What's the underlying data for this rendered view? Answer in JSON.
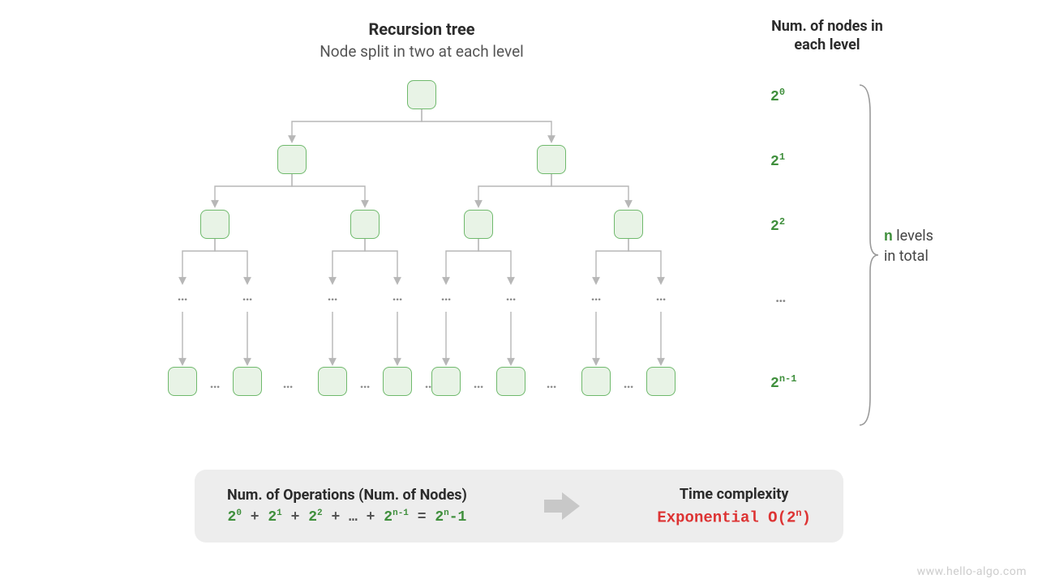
{
  "title": {
    "main": "Recursion tree",
    "sub": "Node split in two at each level"
  },
  "right_header": "Num. of nodes in each level",
  "levels": {
    "l0": "2",
    "l0_sup": "0",
    "l1": "2",
    "l1_sup": "1",
    "l2": "2",
    "l2_sup": "2",
    "ell": "…",
    "ln": "2",
    "ln_sup": "n-1"
  },
  "brace": {
    "n": "n",
    "text_rest": " levels\nin total"
  },
  "callout": {
    "ops_title": "Num. of Operations (Num. of Nodes)",
    "formula_parts": {
      "t0": "2",
      "t0s": "0",
      "t1": "2",
      "t1s": "1",
      "t2": "2",
      "t2s": "2",
      "ell": "…",
      "tn": "2",
      "tns": "n-1",
      "eq": " = ",
      "res": "2",
      "resS": "n",
      "resTail": "-1",
      "plus": " + "
    },
    "tc_title": "Time complexity",
    "tc_label": "Exponential ",
    "tc_o": "O(2",
    "tc_sup": "n",
    "tc_close": ")"
  },
  "ellipsis": "…",
  "watermark": "www.hello-algo.com"
}
